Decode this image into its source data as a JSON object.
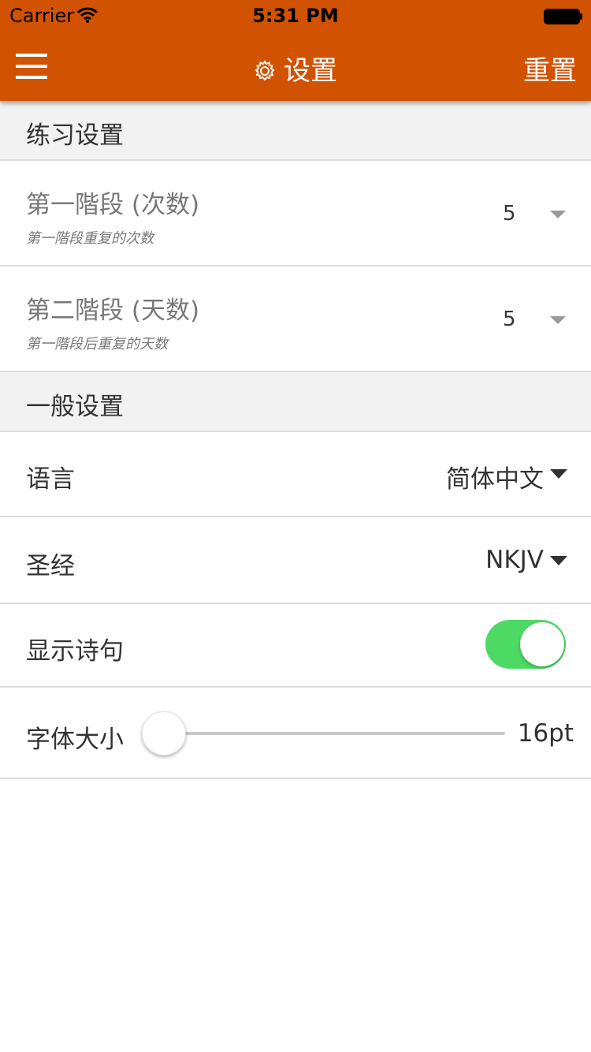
{
  "status_bar": {
    "carrier": "Carrier",
    "time": "5:31 PM"
  },
  "nav": {
    "title": "设置",
    "reset_label": "重置",
    "menu_icon": "hamburger-icon",
    "title_icon": "gear-icon"
  },
  "practice": {
    "header": "练习设置",
    "stage1": {
      "title": "第一階段 (次数)",
      "description": "第一階段重复的次数",
      "value": "5"
    },
    "stage2": {
      "title": "第二階段 (天数)",
      "description": "第一階段后重复的天数",
      "value": "5"
    }
  },
  "general": {
    "header": "一般设置",
    "language": {
      "label": "语言",
      "value": "简体中文"
    },
    "bible": {
      "label": "圣经",
      "value": "NKJV"
    },
    "show_verse": {
      "label": "显示诗句",
      "on": true
    },
    "font_size": {
      "label": "字体大小",
      "value": "16pt",
      "level": 0
    }
  },
  "colors": {
    "accent": "#d15200",
    "toggle_on": "#4cd964"
  }
}
